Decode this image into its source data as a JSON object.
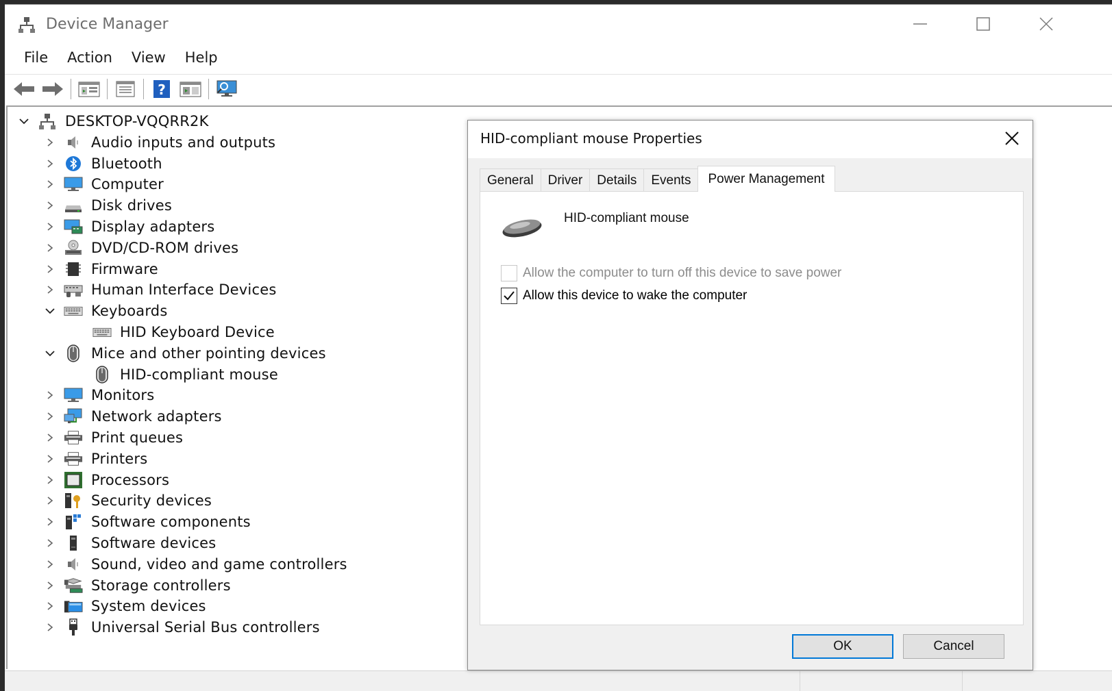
{
  "window": {
    "title": "Device Manager"
  },
  "menu": [
    "File",
    "Action",
    "View",
    "Help"
  ],
  "toolbar": [
    "back-icon",
    "forward-icon",
    "properties-view-icon",
    "update-driver-icon",
    "help-icon",
    "show-hidden-icon",
    "monitor-scan-icon"
  ],
  "tree": {
    "root": "DESKTOP-VQQRR2K",
    "items": [
      {
        "label": "Audio inputs and outputs",
        "icon": "speaker-icon",
        "state": "collapsed"
      },
      {
        "label": "Bluetooth",
        "icon": "bluetooth-icon",
        "state": "collapsed"
      },
      {
        "label": "Computer",
        "icon": "monitor-icon",
        "state": "collapsed"
      },
      {
        "label": "Disk drives",
        "icon": "disk-icon",
        "state": "collapsed"
      },
      {
        "label": "Display adapters",
        "icon": "display-adapter-icon",
        "state": "collapsed"
      },
      {
        "label": "DVD/CD-ROM drives",
        "icon": "dvd-icon",
        "state": "collapsed"
      },
      {
        "label": "Firmware",
        "icon": "chip-icon",
        "state": "collapsed"
      },
      {
        "label": "Human Interface Devices",
        "icon": "hid-icon",
        "state": "collapsed"
      },
      {
        "label": "Keyboards",
        "icon": "keyboard-icon",
        "state": "expanded"
      },
      {
        "label": "HID Keyboard Device",
        "icon": "keyboard-icon",
        "state": "child"
      },
      {
        "label": "Mice and other pointing devices",
        "icon": "mouse-icon",
        "state": "expanded"
      },
      {
        "label": "HID-compliant mouse",
        "icon": "mouse-icon",
        "state": "child"
      },
      {
        "label": "Monitors",
        "icon": "monitor-icon",
        "state": "collapsed"
      },
      {
        "label": "Network adapters",
        "icon": "network-icon",
        "state": "collapsed"
      },
      {
        "label": "Print queues",
        "icon": "printer-icon",
        "state": "collapsed"
      },
      {
        "label": "Printers",
        "icon": "printer-icon",
        "state": "collapsed"
      },
      {
        "label": "Processors",
        "icon": "processor-icon",
        "state": "collapsed"
      },
      {
        "label": "Security devices",
        "icon": "security-icon",
        "state": "collapsed"
      },
      {
        "label": "Software components",
        "icon": "software-component-icon",
        "state": "collapsed"
      },
      {
        "label": "Software devices",
        "icon": "software-device-icon",
        "state": "collapsed"
      },
      {
        "label": "Sound, video and game controllers",
        "icon": "speaker-icon",
        "state": "collapsed"
      },
      {
        "label": "Storage controllers",
        "icon": "storage-icon",
        "state": "collapsed"
      },
      {
        "label": "System devices",
        "icon": "folder-icon",
        "state": "collapsed"
      },
      {
        "label": "Universal Serial Bus controllers",
        "icon": "usb-icon",
        "state": "collapsed"
      }
    ]
  },
  "dialog": {
    "title": "HID-compliant mouse Properties",
    "tabs": [
      "General",
      "Driver",
      "Details",
      "Events",
      "Power Management"
    ],
    "active_tab": "Power Management",
    "device_name": "HID-compliant mouse",
    "options": [
      {
        "label": "Allow the computer to turn off this device to save power",
        "checked": false,
        "enabled": false
      },
      {
        "label": "Allow this device to wake the computer",
        "checked": true,
        "enabled": true
      }
    ],
    "ok_label": "OK",
    "cancel_label": "Cancel"
  },
  "colors": {
    "accent": "#0078d7",
    "text": "#111111",
    "disabled_text": "#8c8c8c",
    "dialog_bg": "#f0f0f0"
  }
}
